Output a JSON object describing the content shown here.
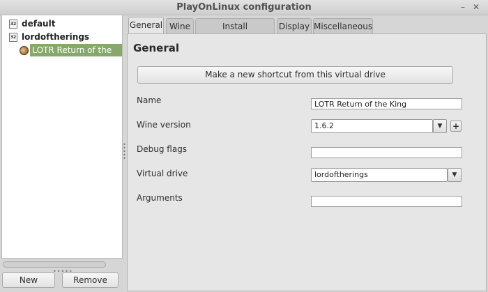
{
  "window": {
    "title": "PlayOnLinux configuration",
    "minimize_glyph": "–",
    "close_glyph": "✕"
  },
  "sidebar": {
    "items": [
      {
        "label": "default",
        "icon": "win32-icon"
      },
      {
        "label": "lordoftherings",
        "icon": "win32-icon"
      }
    ],
    "selected_sub": {
      "label": "LOTR Return of the King",
      "icon": "game-icon"
    },
    "new_label": "New",
    "remove_label": "Remove"
  },
  "tabs": [
    {
      "label": "General",
      "active": true
    },
    {
      "label": "Wine",
      "active": false
    },
    {
      "label": "Install components",
      "active": false
    },
    {
      "label": "Display",
      "active": false
    },
    {
      "label": "Miscellaneous",
      "active": false
    }
  ],
  "general": {
    "heading": "General",
    "shortcut_button": "Make a new shortcut from this virtual drive",
    "name_label": "Name",
    "name_value": "LOTR Return of the King",
    "wine_version_label": "Wine version",
    "wine_version_value": "1.6.2",
    "debug_flags_label": "Debug flags",
    "debug_flags_value": "",
    "virtual_drive_label": "Virtual drive",
    "virtual_drive_value": "lordoftherings",
    "arguments_label": "Arguments",
    "arguments_value": "",
    "dropdown_glyph": "▼",
    "plus_glyph": "+"
  },
  "colors": {
    "selection": "#86a86a",
    "background": "#d6d6d6",
    "panel": "#e6e6e6"
  }
}
